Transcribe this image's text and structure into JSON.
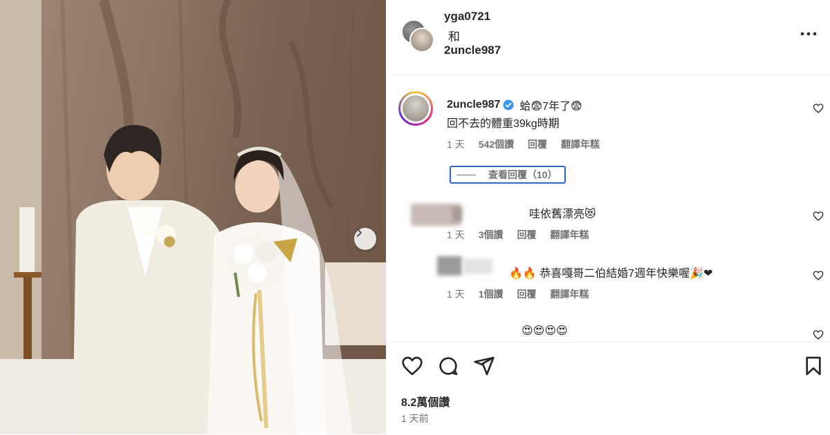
{
  "header": {
    "user1": "yga0721",
    "connector": "和",
    "user2": "2uncle987"
  },
  "caption": {
    "username": "2uncle987",
    "line1": "蛤😨7年了😨",
    "line2": "回不去的體重39kg時期",
    "age": "1 天",
    "views": "542個讚",
    "reply": "回覆",
    "translate": "翻譯年糕",
    "view_replies": "查看回覆（10）"
  },
  "comments": [
    {
      "text": "哇依舊漂亮😻",
      "age": "1 天",
      "likes": "3個讚",
      "reply": "回覆",
      "translate": "翻譯年糕"
    },
    {
      "text": "🔥🔥 恭喜嘎哥二伯結婚7週年快樂喔🎉❤",
      "age": "1 天",
      "likes": "1個讚",
      "reply": "回覆",
      "translate": "翻譯年糕"
    },
    {
      "text": "😍😍😍😍"
    }
  ],
  "post": {
    "likes": "8.2萬個讚",
    "time": "1 天前"
  },
  "colors": {
    "verified": "#3897f0",
    "focus_outline": "#2f64c9",
    "muted": "#737373"
  }
}
